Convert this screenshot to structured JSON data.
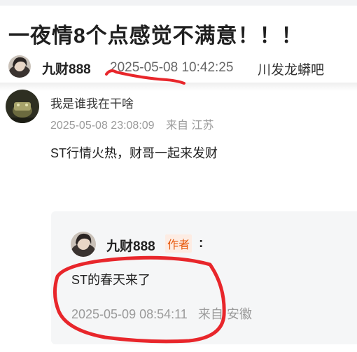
{
  "post": {
    "title": "一夜情8个点感觉不满意！！！",
    "author": "九财888",
    "timestamp": "2025-05-08 10:42:25",
    "forum": "川发龙蟒吧"
  },
  "comment": {
    "author": "我是谁我在干啥",
    "timestamp": "2025-05-08 23:08:09",
    "location": "来自 江苏",
    "text": "ST行情火热，财哥一起来发财"
  },
  "reply": {
    "author": "九财888",
    "badge": "作者",
    "colon": ":",
    "text": "ST的春天来了",
    "timestamp": "2025-05-09 08:54:11",
    "location": "来自 安徽"
  },
  "colors": {
    "annotation_red": "#e8262b",
    "badge_orange": "#e8590c",
    "meta_gray": "#9a9a9a"
  }
}
